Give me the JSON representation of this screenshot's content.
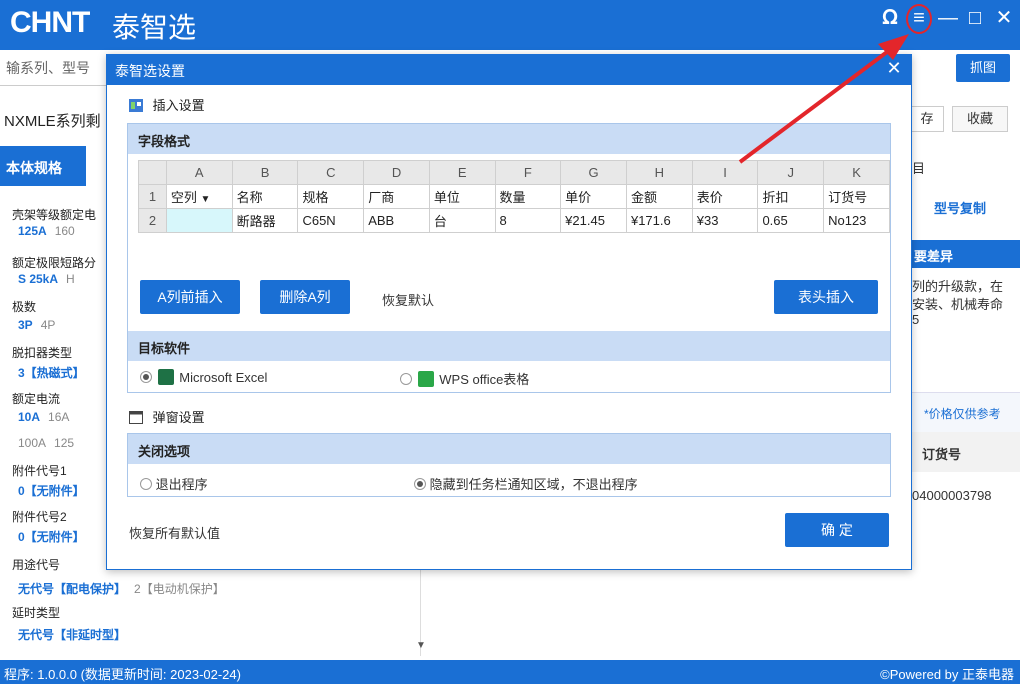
{
  "app": {
    "logo": "CHNT",
    "name": "泰智选",
    "search_placeholder": "输系列、型号",
    "grab_label": "抓图"
  },
  "left": {
    "model_title": "NXMLE系列剩",
    "tab_label": "本体规格",
    "specs": [
      {
        "title": "壳架等级额定电",
        "value": "125A",
        "alt": "160"
      },
      {
        "title": "额定极限短路分",
        "value": "S 25kA",
        "alt": "H"
      },
      {
        "title": "极数",
        "value": "3P",
        "alt": "4P"
      },
      {
        "title": "脱扣器类型",
        "value": "3【热磁式】",
        "alt": ""
      },
      {
        "title": "额定电流",
        "value": "10A",
        "alt": "16A"
      },
      {
        "title": "",
        "value": "100A",
        "alt": "125"
      },
      {
        "title": "附件代号1",
        "value": "0【无附件】",
        "alt": ""
      },
      {
        "title": "附件代号2",
        "value": "0【无附件】",
        "alt": ""
      },
      {
        "title": "用途代号",
        "value": "无代号【配电保护】",
        "alt": "2【电动机保护】"
      },
      {
        "title": "延时类型",
        "value": "无代号【非延时型】",
        "alt": ""
      }
    ]
  },
  "right": {
    "save_label": "存",
    "fav_label": "收藏",
    "mark": "目",
    "copy_model": "型号复制",
    "diff_title": "要差异",
    "desc1": "列的升级款，在",
    "desc2": "安装、机械寿命",
    "desc3": "5",
    "price_note": "*价格仅供参考",
    "order_header": "订货号",
    "order_value": "04000003798"
  },
  "dialog": {
    "title": "泰智选设置",
    "insert_section": "插入设置",
    "field_format": "字段格式",
    "columns": [
      "A",
      "B",
      "C",
      "D",
      "E",
      "F",
      "G",
      "H",
      "I",
      "J",
      "K"
    ],
    "row1": [
      "空列",
      "名称",
      "规格",
      "厂商",
      "单位",
      "数量",
      "单价",
      "金额",
      "表价",
      "折扣",
      "订货号"
    ],
    "row2": [
      "",
      "断路器",
      "C65N",
      "ABB",
      "台",
      "8",
      "¥21.45",
      "¥171.6",
      "¥33",
      "0.65",
      "No123"
    ],
    "insert_before": "A列前插入",
    "delete_col": "删除A列",
    "restore_default": "恢复默认",
    "header_insert": "表头插入",
    "target_software": "目标软件",
    "excel_label": "Microsoft Excel",
    "wps_label": "WPS office表格",
    "popup_section": "弹窗设置",
    "close_options": "关闭选项",
    "exit_program": "退出程序",
    "hide_to_tray": "隐藏到任务栏通知区域，不退出程序",
    "restore_all": "恢复所有默认值",
    "confirm": "确 定"
  },
  "status": {
    "left": "程序: 1.0.0.0  (数据更新时间: 2023-02-24)",
    "right": "©Powered by 正泰电器"
  },
  "colors": {
    "brand_blue": "#1a6fd4",
    "annotation_red": "#e3262b"
  }
}
